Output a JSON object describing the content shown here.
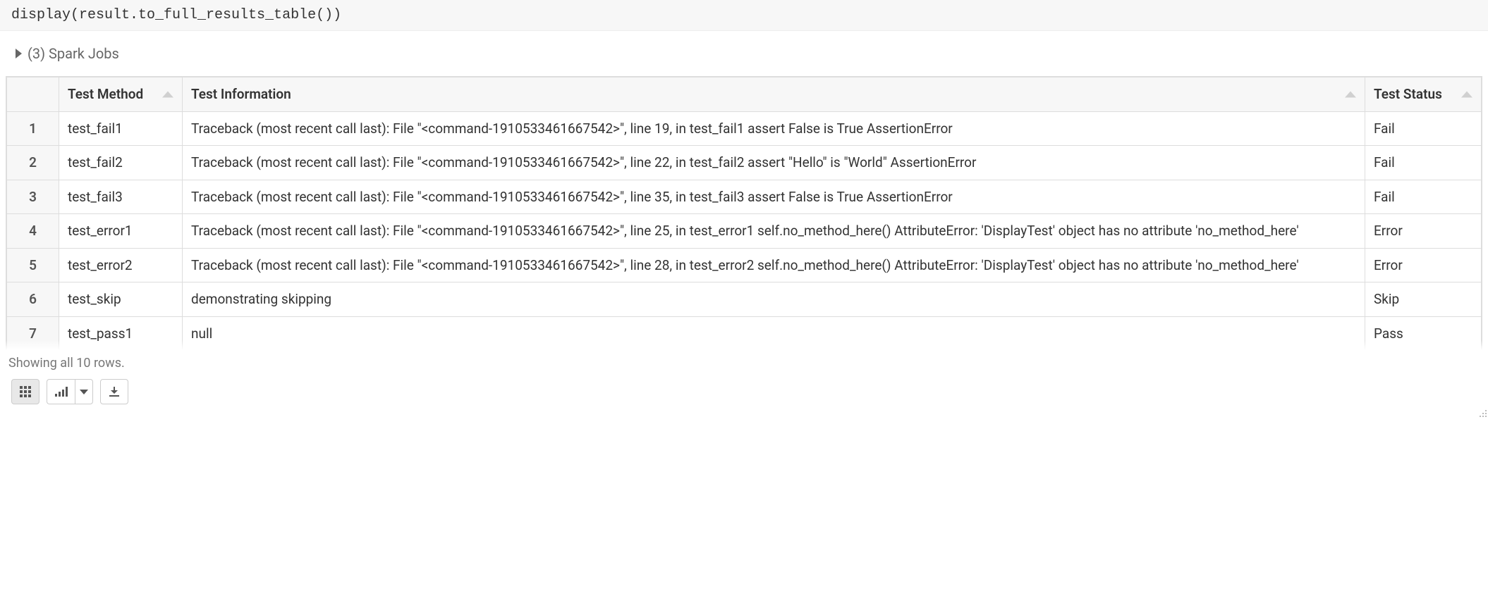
{
  "code_cell": "display(result.to_full_results_table())",
  "spark_jobs_label": "(3) Spark Jobs",
  "columns": {
    "method": "Test Method",
    "info": "Test Information",
    "status": "Test Status"
  },
  "rows": [
    {
      "n": "1",
      "method": "test_fail1",
      "info": "Traceback (most recent call last): File \"<command-1910533461667542>\", line 19, in test_fail1 assert False is True AssertionError",
      "status": "Fail"
    },
    {
      "n": "2",
      "method": "test_fail2",
      "info": "Traceback (most recent call last): File \"<command-1910533461667542>\", line 22, in test_fail2 assert \"Hello\" is \"World\" AssertionError",
      "status": "Fail"
    },
    {
      "n": "3",
      "method": "test_fail3",
      "info": "Traceback (most recent call last): File \"<command-1910533461667542>\", line 35, in test_fail3 assert False is True AssertionError",
      "status": "Fail"
    },
    {
      "n": "4",
      "method": "test_error1",
      "info": "Traceback (most recent call last): File \"<command-1910533461667542>\", line 25, in test_error1 self.no_method_here() AttributeError: 'DisplayTest' object has no attribute 'no_method_here'",
      "status": "Error"
    },
    {
      "n": "5",
      "method": "test_error2",
      "info": "Traceback (most recent call last): File \"<command-1910533461667542>\", line 28, in test_error2 self.no_method_here() AttributeError: 'DisplayTest' object has no attribute 'no_method_here'",
      "status": "Error"
    },
    {
      "n": "6",
      "method": "test_skip",
      "info": "demonstrating skipping",
      "status": "Skip"
    },
    {
      "n": "7",
      "method": "test_pass1",
      "info": "null",
      "status": "Pass"
    }
  ],
  "footer": "Showing all 10 rows."
}
